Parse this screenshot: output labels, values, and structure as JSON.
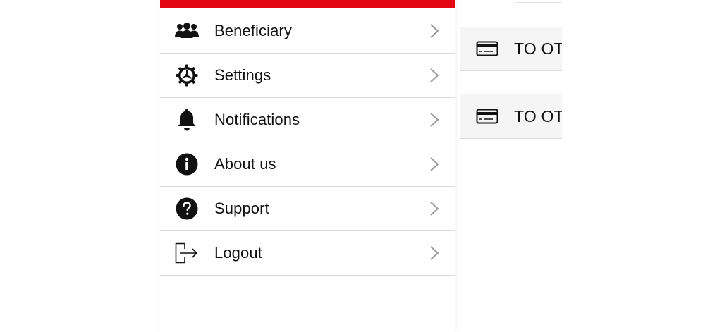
{
  "colors": {
    "brand_red": "#e30613",
    "text": "#111111",
    "divider": "#dadada",
    "chevron": "#9a9a9a"
  },
  "drawer": {
    "menu": [
      {
        "label": "Beneficiary",
        "icon": "users-group-icon"
      },
      {
        "label": "Settings",
        "icon": "gear-icon"
      },
      {
        "label": "Notifications",
        "icon": "bell-icon"
      },
      {
        "label": "About us",
        "icon": "info-icon"
      },
      {
        "label": "Support",
        "icon": "help-icon"
      },
      {
        "label": "Logout",
        "icon": "logout-icon"
      }
    ]
  },
  "background": {
    "rows": [
      {
        "label": "TO OT",
        "icon": "credit-card-icon"
      },
      {
        "label": "TO OT",
        "icon": "credit-card-icon"
      }
    ]
  }
}
